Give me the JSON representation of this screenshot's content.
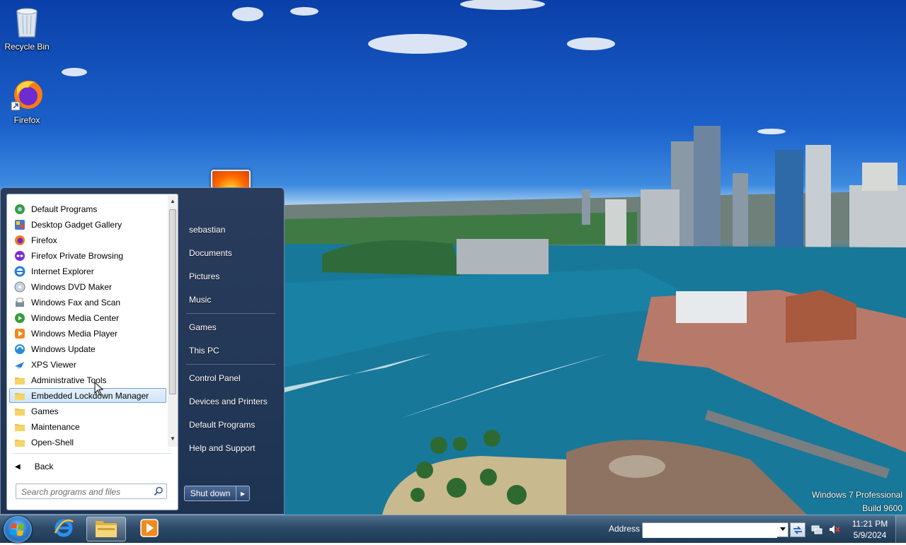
{
  "desktop": {
    "icons": [
      {
        "label": "Recycle Bin",
        "icon": "recycle-bin-icon"
      },
      {
        "label": "Firefox",
        "icon": "firefox-icon"
      }
    ],
    "watermark": {
      "line1": "Windows 7 Professional",
      "line2": "Build 9600"
    }
  },
  "start_menu": {
    "programs": [
      {
        "label": "Default Programs",
        "icon": "default-programs-icon"
      },
      {
        "label": "Desktop Gadget Gallery",
        "icon": "gadget-gallery-icon"
      },
      {
        "label": "Firefox",
        "icon": "firefox-icon"
      },
      {
        "label": "Firefox Private Browsing",
        "icon": "firefox-private-icon"
      },
      {
        "label": "Internet Explorer",
        "icon": "internet-explorer-icon"
      },
      {
        "label": "Windows DVD Maker",
        "icon": "dvd-maker-icon"
      },
      {
        "label": "Windows Fax and Scan",
        "icon": "fax-scan-icon"
      },
      {
        "label": "Windows Media Center",
        "icon": "media-center-icon"
      },
      {
        "label": "Windows Media Player",
        "icon": "media-player-icon"
      },
      {
        "label": "Windows Update",
        "icon": "windows-update-icon"
      },
      {
        "label": "XPS Viewer",
        "icon": "xps-viewer-icon"
      },
      {
        "label": "Administrative Tools",
        "icon": "folder-icon"
      },
      {
        "label": "Embedded Lockdown Manager",
        "icon": "folder-icon",
        "selected": true
      },
      {
        "label": "Games",
        "icon": "folder-icon"
      },
      {
        "label": "Maintenance",
        "icon": "folder-icon"
      },
      {
        "label": "Open-Shell",
        "icon": "folder-icon"
      }
    ],
    "back_label": "Back",
    "search_placeholder": "Search programs and files",
    "right_pane": [
      {
        "label": "sebastian"
      },
      {
        "label": "Documents"
      },
      {
        "label": "Pictures"
      },
      {
        "label": "Music"
      },
      {
        "label": "Games"
      },
      {
        "label": "This PC"
      },
      {
        "label": "Control Panel"
      },
      {
        "label": "Devices and Printers"
      },
      {
        "label": "Default Programs"
      },
      {
        "label": "Help and Support"
      }
    ],
    "shutdown_label": "Shut down"
  },
  "taskbar": {
    "pinned": [
      {
        "name": "internet-explorer-icon"
      },
      {
        "name": "file-explorer-icon",
        "active": true
      },
      {
        "name": "media-player-icon"
      }
    ],
    "address_label": "Address",
    "address_value": "",
    "clock": {
      "time": "11:21 PM",
      "date": "5/9/2024"
    },
    "tray": [
      "network-icon",
      "volume-muted-icon"
    ]
  },
  "colors": {
    "taskbar": "#2c4a68",
    "start_menu": "#1e3352",
    "selection": "#cfe4f9",
    "accent": "#7da2ce"
  }
}
